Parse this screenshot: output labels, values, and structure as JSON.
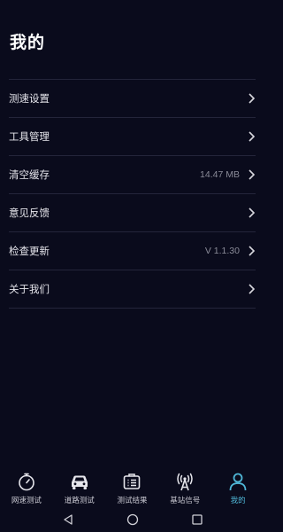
{
  "header": {
    "title": "我的"
  },
  "menu": {
    "items": [
      {
        "label": "测速设置",
        "value": ""
      },
      {
        "label": "工具管理",
        "value": ""
      },
      {
        "label": "清空缓存",
        "value": "14.47 MB"
      },
      {
        "label": "意见反馈",
        "value": ""
      },
      {
        "label": "检查更新",
        "value": "V 1.1.30"
      },
      {
        "label": "关于我们",
        "value": ""
      }
    ]
  },
  "tabbar": {
    "tabs": [
      {
        "label": "网速测试",
        "icon": "stopwatch-icon"
      },
      {
        "label": "道路测试",
        "icon": "car-icon"
      },
      {
        "label": "测试结果",
        "icon": "report-icon"
      },
      {
        "label": "基站信号",
        "icon": "signal-tower-icon"
      },
      {
        "label": "我的",
        "icon": "user-icon",
        "active": true
      }
    ],
    "active_color": "#4fb6d6"
  },
  "system_nav": {
    "buttons": [
      "back",
      "home",
      "recents"
    ]
  }
}
